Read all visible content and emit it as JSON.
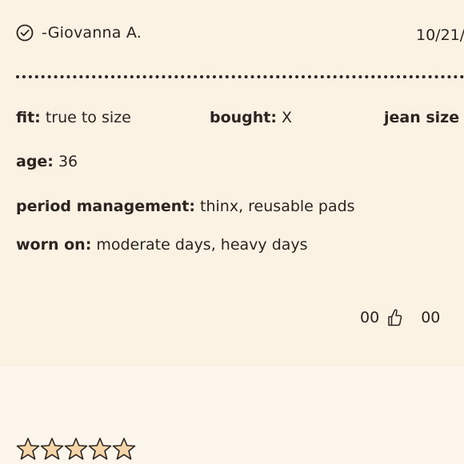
{
  "review": {
    "reviewer": "-Giovanna A.",
    "date": "10/21/",
    "attributes": {
      "fit": {
        "label": "fit:",
        "value": "true to size"
      },
      "bought": {
        "label": "bought:",
        "value": "X"
      },
      "jean": {
        "label": "jean size",
        "value": ""
      },
      "age": {
        "label": "age:",
        "value": "36"
      },
      "period": {
        "label": "period management:",
        "value": "thinx, reusable pads"
      },
      "worn": {
        "label": "worn on:",
        "value": "moderate days, heavy days"
      }
    },
    "helpful": {
      "up_count": "00",
      "down_count": "00",
      "icon": "thumbs-up-icon"
    },
    "verified_icon": "check-circle-icon"
  },
  "next_review": {
    "rating": 5,
    "max_rating": 5,
    "star_fill": "#f6d6a8",
    "star_stroke": "#2a2520"
  }
}
